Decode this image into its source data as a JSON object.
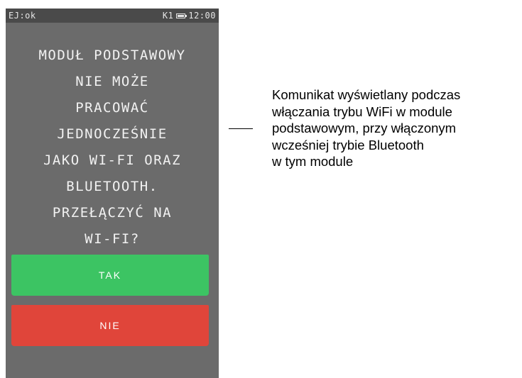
{
  "device": {
    "status_bar": {
      "left_text": "EJ:ok",
      "channel": "K1",
      "battery_icon": "battery-icon",
      "time": "12:00"
    },
    "message_lines": [
      "MODUŁ PODSTAWOWY",
      "NIE MOŻE",
      "PRACOWAĆ",
      "JEDNOCZEŚNIE",
      "JAKO WI-FI ORAZ",
      "BLUETOOTH.",
      "PRZEŁĄCZYĆ NA",
      "WI-FI?"
    ],
    "buttons": {
      "yes_label": "TAK",
      "no_label": "NIE"
    },
    "colors": {
      "screen_background": "#6b6b6b",
      "status_bar": "#4a4a4a",
      "yes_button": "#3cc463",
      "no_button": "#e0453a"
    }
  },
  "annotation": {
    "lines": [
      "Komunikat wyświetlany podczas",
      "włączania trybu WiFi w module",
      "podstawowym, przy włączonym",
      "wcześniej trybie Bluetooth",
      "w tym module"
    ]
  }
}
